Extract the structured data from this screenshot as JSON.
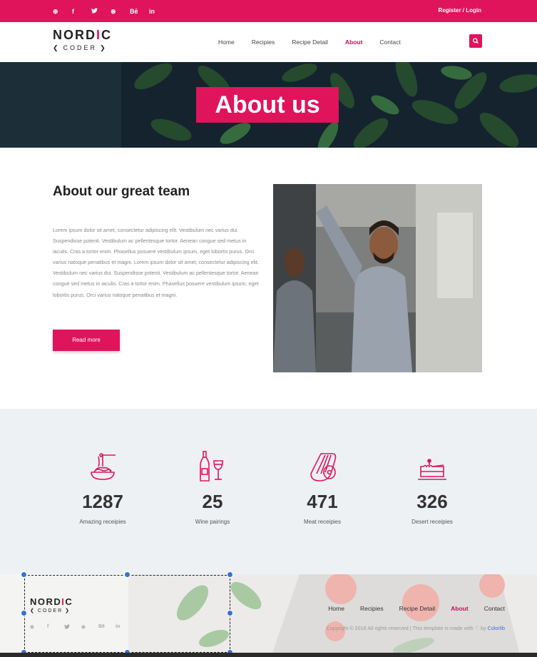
{
  "topbar": {
    "socials": [
      "pinterest-icon",
      "facebook-icon",
      "twitter-icon",
      "dribbble-icon",
      "behance-icon",
      "linkedin-icon"
    ],
    "social_glyphs": [
      "⊕",
      "f",
      "🐦",
      "⊛",
      "Bē",
      "in"
    ],
    "auth_label": "Register / Login"
  },
  "brand": {
    "top": "NORDIC",
    "bottom": "CODER"
  },
  "nav": {
    "items": [
      "Home",
      "Recipies",
      "Recipe Detail",
      "About",
      "Contact"
    ],
    "active": "About"
  },
  "hero": {
    "title": "About us"
  },
  "about": {
    "heading": "About our great team",
    "body": "Lorem ipsum dolor sit amet, consectetur adipiscing elit. Vestibulum nec varius dui. Suspendisse potenti. Vestibulum ac pellentesque tortor. Aenean congue sed metus in iaculis. Cras a tortor enim. Phasellus posuere vestibulum ipsum, eget lobortis purus. Orci varius natoque penatibus et magni. Lorem ipsum dolor sit amet, consectetur adipiscing elit. Vestibulum nec varius dui. Suspendisse potenti. Vestibulum ac pellentesque tortor. Aenean congue sed metus in iaculis. Cras a tortor enim. Phasellus posuere vestibulum ipsum, eget lobortis purus. Orci varius natoque penatibus et magni.",
    "button": "Read more"
  },
  "stats": [
    {
      "value": "1287",
      "label": "Amazing receipies",
      "icon": "spaghetti-icon"
    },
    {
      "value": "25",
      "label": "Wine pairings",
      "icon": "wine-icon"
    },
    {
      "value": "471",
      "label": "Meat receipies",
      "icon": "meat-icon"
    },
    {
      "value": "326",
      "label": "Desert receipies",
      "icon": "cake-icon"
    }
  ],
  "footer": {
    "nav": [
      "Home",
      "Recipies",
      "Recipe Detail",
      "About",
      "Contact"
    ],
    "copyright_prefix": "Copyright © 2018 All rights reserved | This template is made with ♡ by ",
    "copyright_link": "Colorlib"
  },
  "colors": {
    "accent": "#e0145a",
    "stats_bg": "#eef1f4",
    "link": "#3b6fd4"
  }
}
